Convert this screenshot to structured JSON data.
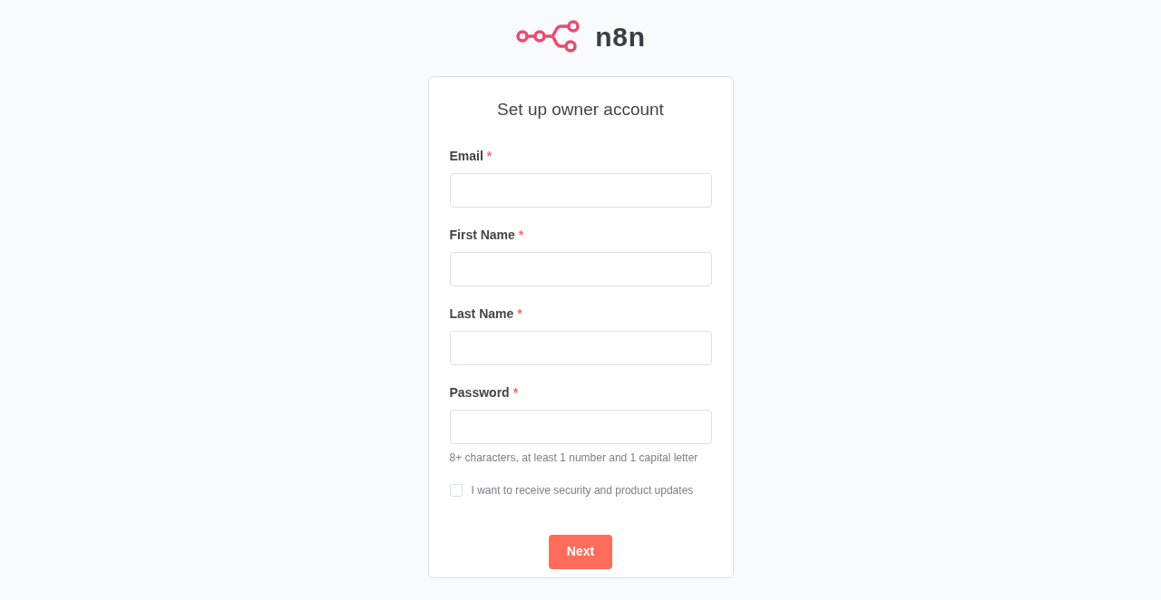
{
  "logo": {
    "text": "n8n"
  },
  "form": {
    "title": "Set up owner account",
    "fields": [
      {
        "label": "Email",
        "required_mark": "*"
      },
      {
        "label": "First Name",
        "required_mark": "*"
      },
      {
        "label": "Last Name",
        "required_mark": "*"
      },
      {
        "label": "Password",
        "required_mark": "*",
        "hint": "8+ characters, at least 1 number and 1 capital letter"
      }
    ],
    "checkbox": {
      "label": "I want to receive security and product updates",
      "checked": false
    },
    "buttons": [
      "Next"
    ]
  }
}
